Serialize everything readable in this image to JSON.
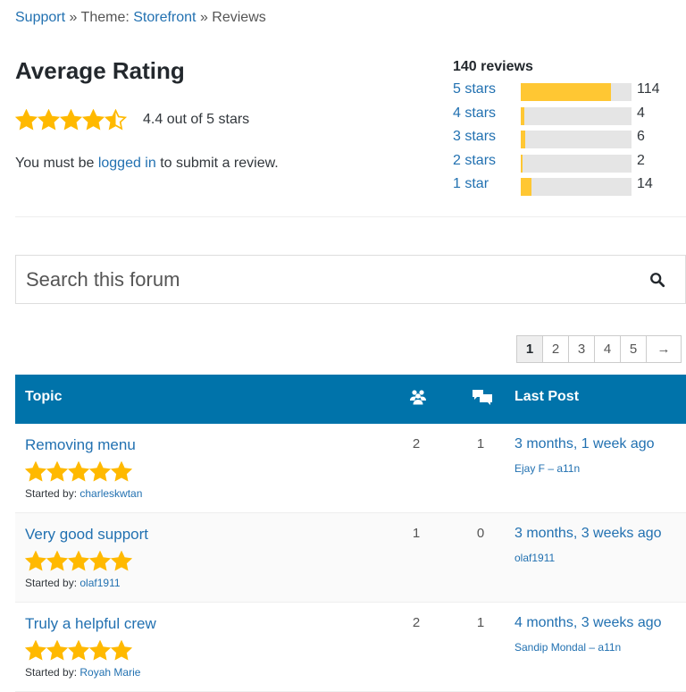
{
  "breadcrumb": {
    "support": "Support",
    "sep1": " » ",
    "theme_prefix": "Theme: ",
    "theme": "Storefront",
    "sep2": " » ",
    "current": "Reviews"
  },
  "average": {
    "title": "Average Rating",
    "rating_text": "4.4 out of 5 stars",
    "rating_value": 4.4,
    "login_prefix": "You must be ",
    "login_link": "logged in",
    "login_suffix": " to submit a review."
  },
  "breakdown": {
    "total": "140 reviews",
    "rows": [
      {
        "label": "5 stars",
        "count": "114",
        "value": 114
      },
      {
        "label": "4 stars",
        "count": "4",
        "value": 4
      },
      {
        "label": "3 stars",
        "count": "6",
        "value": 6
      },
      {
        "label": "2 stars",
        "count": "2",
        "value": 2
      },
      {
        "label": "1 star",
        "count": "14",
        "value": 14
      }
    ],
    "max": 140
  },
  "search": {
    "placeholder": "Search this forum"
  },
  "pagination": {
    "pages": [
      "1",
      "2",
      "3",
      "4",
      "5",
      "→"
    ],
    "current": "1"
  },
  "table": {
    "col_topic": "Topic",
    "col_last": "Last Post",
    "rows": [
      {
        "title": "Removing menu",
        "started_label": "Started by:",
        "started_by": "charleskwtan",
        "voices": "2",
        "posts": "1",
        "last": "3 months, 1 week ago",
        "author": "Ejay F – a11n",
        "stars": 5
      },
      {
        "title": "Very good support",
        "started_label": "Started by:",
        "started_by": "olaf1911",
        "voices": "1",
        "posts": "0",
        "last": "3 months, 3 weeks ago",
        "author": "olaf1911",
        "stars": 5
      },
      {
        "title": "Truly a helpful crew",
        "started_label": "Started by:",
        "started_by": "Royah Marie",
        "voices": "2",
        "posts": "1",
        "last": "4 months, 3 weeks ago",
        "author": "Sandip Mondal – a11n",
        "stars": 5
      }
    ]
  },
  "colors": {
    "accent": "#0073aa",
    "link": "#2271b1",
    "star": "#ffb900",
    "bar": "#ffc733"
  }
}
